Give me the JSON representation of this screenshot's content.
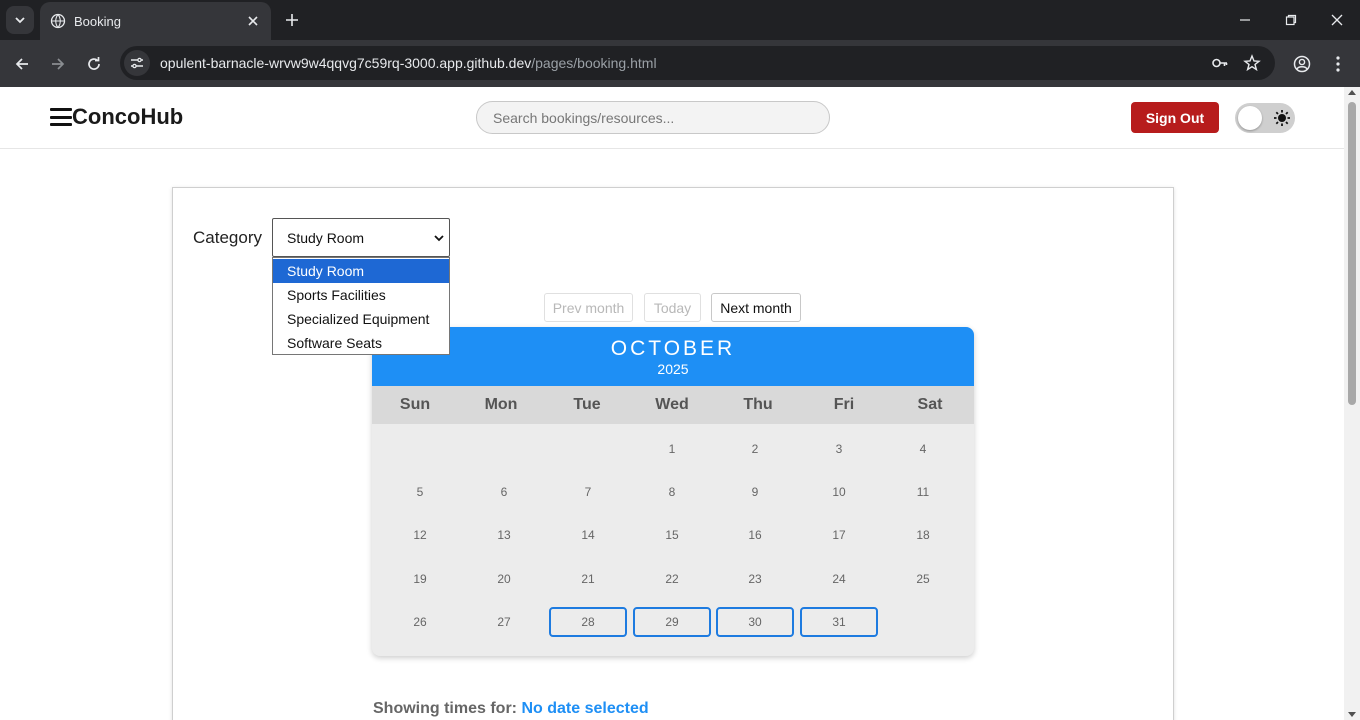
{
  "browser": {
    "tab_title": "Booking",
    "url_host": "opulent-barnacle-wrvw9w4qqvg7c59rq-3000.app.github.dev",
    "url_path": "/pages/booking.html"
  },
  "header": {
    "brand": "ConcoHub",
    "search_placeholder": "Search bookings/resources...",
    "signout_label": "Sign Out",
    "accent_color": "#b71c1c"
  },
  "booking": {
    "category_label": "Category",
    "selected_category": "Study Room",
    "category_options": [
      "Study Room",
      "Sports Facilities",
      "Specialized Equipment",
      "Software Seats"
    ],
    "prev_label": "Prev month",
    "today_label": "Today",
    "next_label": "Next month",
    "showing_label": "Showing times for:",
    "showing_value": "No date selected"
  },
  "calendar": {
    "month": "OCTOBER",
    "year": "2025",
    "header_color": "#1e8ff5",
    "weekdays": [
      "Sun",
      "Mon",
      "Tue",
      "Wed",
      "Thu",
      "Fri",
      "Sat"
    ],
    "days": [
      "",
      "",
      "",
      "1",
      "2",
      "3",
      "4",
      "5",
      "6",
      "7",
      "8",
      "9",
      "10",
      "11",
      "12",
      "13",
      "14",
      "15",
      "16",
      "17",
      "18",
      "19",
      "20",
      "21",
      "22",
      "23",
      "24",
      "25",
      "26",
      "27",
      "28",
      "29",
      "30",
      "31",
      ""
    ],
    "available_days": [
      "28",
      "29",
      "30",
      "31"
    ]
  }
}
